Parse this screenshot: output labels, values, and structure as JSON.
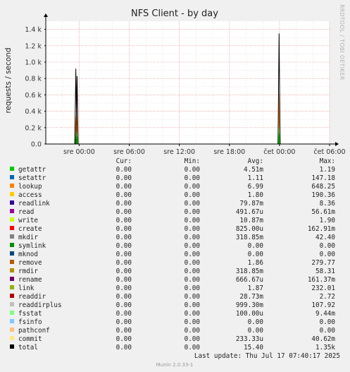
{
  "chart_data": {
    "type": "area",
    "title": "NFS Client - by day",
    "ylabel": "requests / second",
    "side_label": "RRDTOOL / TOBI OETIKER",
    "ylim": [
      0,
      1500
    ],
    "y_ticks": [
      {
        "value": 0,
        "label": "0.0"
      },
      {
        "value": 200,
        "label": "0.2 k"
      },
      {
        "value": 400,
        "label": "0.4 k"
      },
      {
        "value": 600,
        "label": "0.6 k"
      },
      {
        "value": 800,
        "label": "0.8 k"
      },
      {
        "value": 1000,
        "label": "1.0 k"
      },
      {
        "value": 1200,
        "label": "1.2 k"
      },
      {
        "value": 1400,
        "label": "1.4 k"
      }
    ],
    "x_range_hours": [
      -4,
      30
    ],
    "x_ticks": [
      {
        "hours": 0,
        "label": "sre 00:00"
      },
      {
        "hours": 6,
        "label": "sre 06:00"
      },
      {
        "hours": 12,
        "label": "sre 12:00"
      },
      {
        "hours": 18,
        "label": "sre 18:00"
      },
      {
        "hours": 24,
        "label": "čet 00:00"
      },
      {
        "hours": 30,
        "label": "čet 06:00"
      }
    ],
    "grid": true,
    "spikes": [
      {
        "hours": -0.4,
        "total": 920,
        "lookup": 370,
        "fsstat": 170,
        "getattr": 120
      },
      {
        "hours": -0.25,
        "total": 830,
        "lookup": 360,
        "fsstat": 160,
        "getattr": 110
      },
      {
        "hours": 23.95,
        "total": 1350,
        "lookup": 648,
        "fsstat": 230,
        "getattr": 150
      }
    ],
    "legend_headers": {
      "cur": "Cur:",
      "min": "Min:",
      "avg": "Avg:",
      "max": "Max:"
    },
    "series": [
      {
        "name": "getattr",
        "color": "#00cc00",
        "cur": "0.00",
        "min": "0.00",
        "avg": "4.51m",
        "max": "1.19"
      },
      {
        "name": "setattr",
        "color": "#0066b3",
        "cur": "0.00",
        "min": "0.00",
        "avg": "1.11",
        "max": "147.18"
      },
      {
        "name": "lookup",
        "color": "#ff8000",
        "cur": "0.00",
        "min": "0.00",
        "avg": "6.99",
        "max": "648.25"
      },
      {
        "name": "access",
        "color": "#ffcc00",
        "cur": "0.00",
        "min": "0.00",
        "avg": "1.80",
        "max": "190.36"
      },
      {
        "name": "readlink",
        "color": "#330099",
        "cur": "0.00",
        "min": "0.00",
        "avg": "79.87m",
        "max": "8.36"
      },
      {
        "name": "read",
        "color": "#990099",
        "cur": "0.00",
        "min": "0.00",
        "avg": "491.67u",
        "max": "56.61m"
      },
      {
        "name": "write",
        "color": "#ccff00",
        "cur": "0.00",
        "min": "0.00",
        "avg": "10.87m",
        "max": "1.90"
      },
      {
        "name": "create",
        "color": "#ff0000",
        "cur": "0.00",
        "min": "0.00",
        "avg": "825.00u",
        "max": "162.91m"
      },
      {
        "name": "mkdir",
        "color": "#808080",
        "cur": "0.00",
        "min": "0.00",
        "avg": "318.85m",
        "max": "42.40"
      },
      {
        "name": "symlink",
        "color": "#008f00",
        "cur": "0.00",
        "min": "0.00",
        "avg": "0.00",
        "max": "0.00"
      },
      {
        "name": "mknod",
        "color": "#00487d",
        "cur": "0.00",
        "min": "0.00",
        "avg": "0.00",
        "max": "0.00"
      },
      {
        "name": "remove",
        "color": "#b35a00",
        "cur": "0.00",
        "min": "0.00",
        "avg": "1.86",
        "max": "279.77"
      },
      {
        "name": "rmdir",
        "color": "#b38f00",
        "cur": "0.00",
        "min": "0.00",
        "avg": "318.85m",
        "max": "58.31"
      },
      {
        "name": "rename",
        "color": "#6b006b",
        "cur": "0.00",
        "min": "0.00",
        "avg": "666.67u",
        "max": "161.37m"
      },
      {
        "name": "link",
        "color": "#8fb300",
        "cur": "0.00",
        "min": "0.00",
        "avg": "1.87",
        "max": "232.01"
      },
      {
        "name": "readdir",
        "color": "#b30000",
        "cur": "0.00",
        "min": "0.00",
        "avg": "28.73m",
        "max": "2.72"
      },
      {
        "name": "readdirplus",
        "color": "#bebebe",
        "cur": "0.00",
        "min": "0.00",
        "avg": "999.30m",
        "max": "107.92"
      },
      {
        "name": "fsstat",
        "color": "#80ff80",
        "cur": "0.00",
        "min": "0.00",
        "avg": "100.00u",
        "max": "9.44m"
      },
      {
        "name": "fsinfo",
        "color": "#80c9ff",
        "cur": "0.00",
        "min": "0.00",
        "avg": "0.00",
        "max": "0.00"
      },
      {
        "name": "pathconf",
        "color": "#ffc080",
        "cur": "0.00",
        "min": "0.00",
        "avg": "0.00",
        "max": "0.00"
      },
      {
        "name": "commit",
        "color": "#ffe680",
        "cur": "0.00",
        "min": "0.00",
        "avg": "233.33u",
        "max": "40.62m"
      },
      {
        "name": "total",
        "color": "#000000",
        "cur": "0.00",
        "min": "0.00",
        "avg": "15.40",
        "max": "1.35k"
      }
    ],
    "last_update": "Last update: Thu Jul 17 07:40:17 2025",
    "footer": "Munin 2.0.33-1"
  }
}
